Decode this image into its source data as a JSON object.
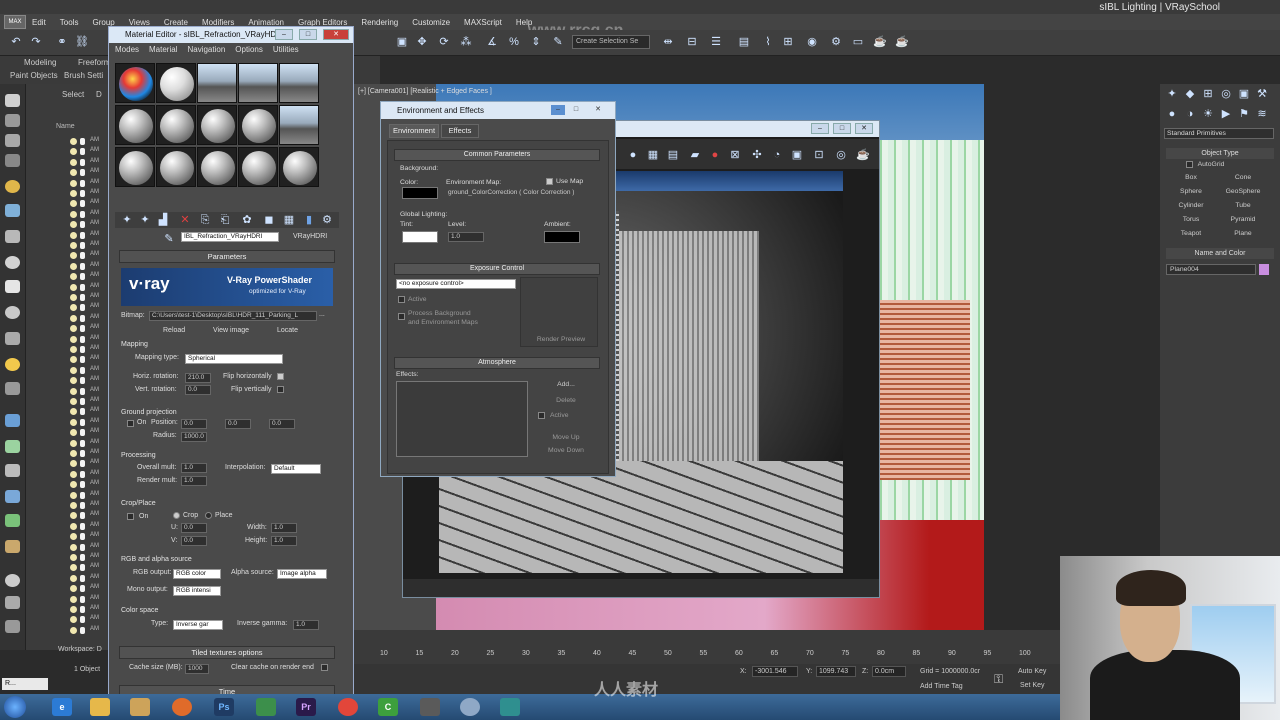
{
  "app_title": "sIBL Lighting | VRaySchool",
  "main_menu": [
    "Edit",
    "Tools",
    "Group",
    "Views",
    "Create",
    "Modifiers",
    "Animation",
    "Graph Editors",
    "Rendering",
    "Customize",
    "MAXScript",
    "Help"
  ],
  "toolbar": {
    "selection_set": "Create Selection Se"
  },
  "ribbon": {
    "tabs": [
      "Modeling",
      "Freeform"
    ],
    "sub": [
      "Paint Objects",
      "Brush Setti"
    ]
  },
  "explorer": {
    "select_label": "Select",
    "display_label": "D",
    "column": "Name",
    "row_label": "AM"
  },
  "material_editor": {
    "title": "Material Editor - sIBL_Refraction_VRayHDRI",
    "menus": [
      "Modes",
      "Material",
      "Navigation",
      "Options",
      "Utilities"
    ],
    "mat_name": "IBL_Refraction_VRayHDRI",
    "mat_type": "VRayHDRI",
    "rollout_parameters": "Parameters",
    "vray_logo": "v·ray",
    "vray_title": "V-Ray PowerShader",
    "vray_sub": "optimized for V-Ray",
    "bitmap_label": "Bitmap:",
    "bitmap_path": "C:\\Users\\test-1\\Desktop\\sIBL\\HDR_111_Parking_L",
    "reload": "Reload",
    "view_image": "View image",
    "locate": "Locate",
    "mapping": "Mapping",
    "mapping_type_label": "Mapping type:",
    "mapping_type": "Spherical",
    "horiz_rotation_label": "Horiz. rotation:",
    "horiz_rotation": "210.0",
    "flip_h": "Flip horizontally",
    "vert_rotation_label": "Vert. rotation:",
    "vert_rotation": "0.0",
    "flip_v": "Flip vertically",
    "ground_projection": "Ground projection",
    "on": "On",
    "position_label": "Position:",
    "pos_x": "0.0",
    "pos_y": "0.0",
    "pos_z": "0.0",
    "radius_label": "Radius:",
    "radius": "1000.0",
    "processing": "Processing",
    "overall_mult_label": "Overall mult:",
    "overall_mult": "1.0",
    "interpolation_label": "Interpolation:",
    "interpolation": "Default",
    "render_mult_label": "Render mult:",
    "render_mult": "1.0",
    "crop_place": "Crop/Place",
    "crop_on": "On",
    "crop": "Crop",
    "place": "Place",
    "u_label": "U:",
    "u": "0.0",
    "width_label": "Width:",
    "width": "1.0",
    "v_label": "V:",
    "v": "0.0",
    "height_label": "Height:",
    "height": "1.0",
    "rgb_alpha": "RGB and alpha source",
    "rgb_output_label": "RGB output:",
    "rgb_output": "RGB color",
    "alpha_source_label": "Alpha source:",
    "alpha_source": "Image alpha",
    "mono_output_label": "Mono output:",
    "mono_output": "RGB intensi",
    "color_space": "Color space",
    "type_label": "Type:",
    "type": "Inverse gar",
    "inverse_gamma_label": "Inverse gamma:",
    "inverse_gamma": "1.0",
    "tiled_textures": "Tiled textures options",
    "cache_size_label": "Cache size (MB):",
    "cache_size": "1000",
    "clear_cache": "Clear cache on render end",
    "time": "Time"
  },
  "viewport": {
    "label": "[+] [Camera001] [Realistic + Edged Faces ]"
  },
  "env": {
    "title": "Environment and Effects",
    "tabs": [
      "Environment",
      "Effects"
    ],
    "common_parameters": "Common Parameters",
    "background": "Background:",
    "color": "Color:",
    "environment_map": "Environment Map:",
    "use_map": "Use Map",
    "map_name": "ground_ColorCorrection  ( Color Correction )",
    "global_lighting": "Global Lighting:",
    "tint": "Tint:",
    "level": "Level:",
    "level_value": "1.0",
    "ambient": "Ambient:",
    "exposure_control": "Exposure Control",
    "exposure_value": "<no exposure control>",
    "active": "Active",
    "process_bg": "Process Background",
    "and_env_maps": "and Environment Maps",
    "render_preview": "Render Preview",
    "atmosphere": "Atmosphere",
    "effects": "Effects:",
    "add": "Add...",
    "delete": "Delete",
    "active2": "Active",
    "move_up": "Move Up",
    "move_down": "Move Down"
  },
  "cmd_panel": {
    "dropdown": "Standard Primitives",
    "object_type": "Object Type",
    "autogrid": "AutoGrid",
    "buttons": [
      "Box",
      "Cone",
      "Sphere",
      "GeoSphere",
      "Cylinder",
      "Tube",
      "Torus",
      "Pyramid",
      "Teapot",
      "Plane"
    ],
    "name_and_color": "Name and Color",
    "object_name": "Plane004"
  },
  "timeline": {
    "ticks": [
      "10",
      "15",
      "20",
      "25",
      "30",
      "35",
      "40",
      "45",
      "50",
      "55",
      "60",
      "65",
      "70",
      "75",
      "80",
      "85",
      "90",
      "95",
      "100"
    ]
  },
  "status": {
    "objects": "1 Object",
    "x_label": "X:",
    "x": "-3001.546",
    "y_label": "Y:",
    "y": "1099.743",
    "z_label": "Z:",
    "z": "0.0cm",
    "grid": "Grid = 1000000.0cr",
    "add_time_tag": "Add Time Tag",
    "auto_key": "Auto Key",
    "set_key": "Set Key",
    "workspace": "Workspace: D"
  },
  "watermark": "www.rrcg.cn",
  "watermark2": "人人素材",
  "taskbar_apps": [
    "e",
    "Ps",
    "Pr",
    "C"
  ]
}
